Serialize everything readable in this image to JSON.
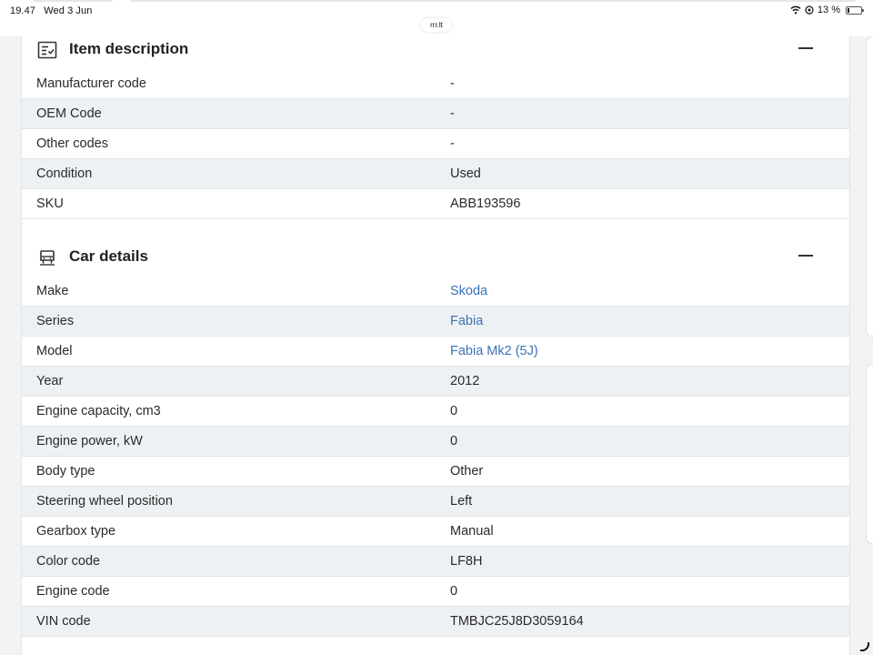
{
  "status_bar": {
    "time": "19.47",
    "date": "Wed 3 Jun",
    "battery": "13 %",
    "url": "rrr.lt"
  },
  "item_description": {
    "title": "Item description",
    "icon": "checklist-icon",
    "rows": [
      {
        "label": "Manufacturer code",
        "value": "-"
      },
      {
        "label": "OEM Code",
        "value": "-"
      },
      {
        "label": "Other codes",
        "value": "-"
      },
      {
        "label": "Condition",
        "value": "Used"
      },
      {
        "label": "SKU",
        "value": "ABB193596"
      }
    ]
  },
  "car_details": {
    "title": "Car details",
    "icon": "car-icon",
    "rows": [
      {
        "label": "Make",
        "value": "Skoda",
        "link": true
      },
      {
        "label": "Series",
        "value": "Fabia",
        "link": true
      },
      {
        "label": "Model",
        "value": "Fabia Mk2 (5J)",
        "link": true
      },
      {
        "label": "Year",
        "value": "2012"
      },
      {
        "label": "Engine capacity, cm3",
        "value": "0"
      },
      {
        "label": "Engine power, kW",
        "value": "0"
      },
      {
        "label": "Body type",
        "value": "Other"
      },
      {
        "label": "Steering wheel position",
        "value": "Left"
      },
      {
        "label": "Gearbox type",
        "value": "Manual"
      },
      {
        "label": "Color code",
        "value": "LF8H"
      },
      {
        "label": "Engine code",
        "value": "0"
      },
      {
        "label": "VIN code",
        "value": "TMBJC25J8D3059164"
      }
    ]
  },
  "colors": {
    "link": "#3b72b7",
    "row_alt": "#eef1f4"
  }
}
